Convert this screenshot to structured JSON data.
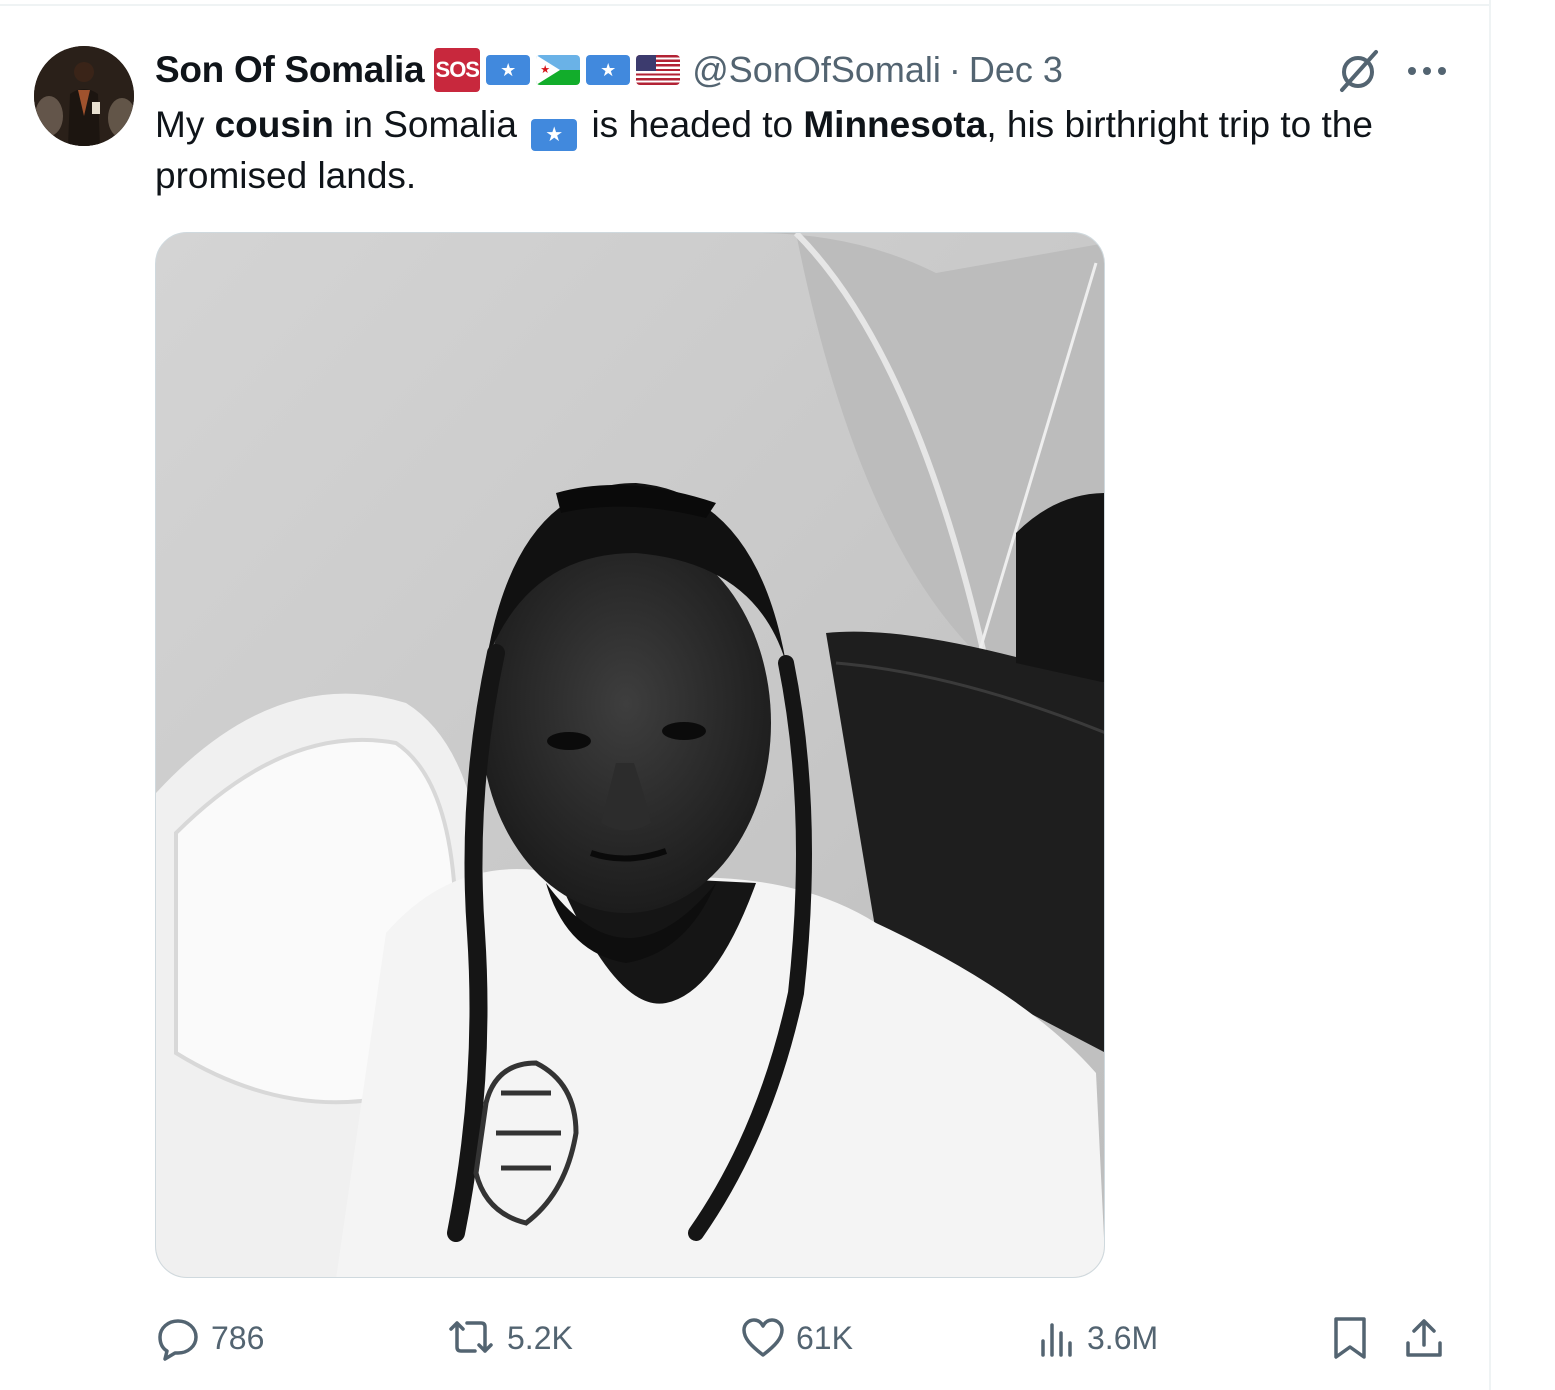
{
  "author": {
    "display_name": "Son Of Somalia",
    "badge_text": "SOS",
    "handle": "@SonOfSomali",
    "separator": "·",
    "date": "Dec 3",
    "badges": [
      "sos-badge",
      "flag-somalia",
      "flag-djibouti",
      "flag-somalia",
      "flag-usa"
    ]
  },
  "tweet": {
    "part1": "My ",
    "bold1": "cousin",
    "part2": " in Somalia ",
    "part3": " is headed to ",
    "bold2": "Minnesota",
    "part4": ", his birthright trip to the promised lands."
  },
  "media": {
    "description_icon": "photo"
  },
  "actions": {
    "replies": "786",
    "reposts": "5.2K",
    "likes": "61K",
    "views": "3.6M"
  },
  "colors": {
    "text": "#0f1419",
    "muted": "#536471",
    "sos_badge": "#c8283d",
    "somalia_blue": "#4189dd"
  }
}
